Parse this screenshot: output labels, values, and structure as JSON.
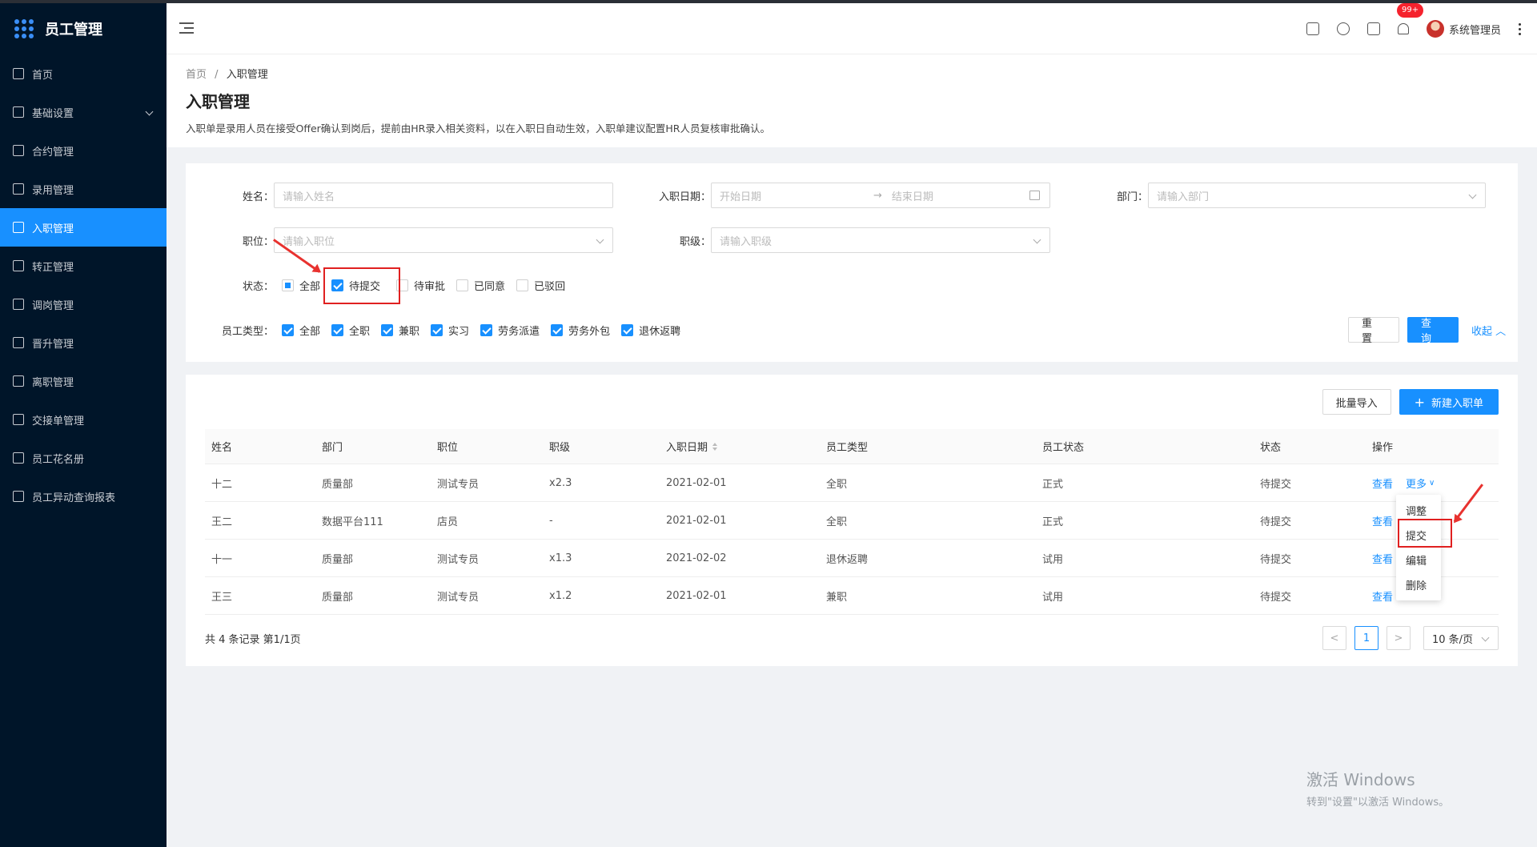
{
  "app": {
    "title": "员工管理"
  },
  "sidebar": {
    "items": [
      {
        "label": "首页"
      },
      {
        "label": "基础设置"
      },
      {
        "label": "合约管理"
      },
      {
        "label": "录用管理"
      },
      {
        "label": "入职管理"
      },
      {
        "label": "转正管理"
      },
      {
        "label": "调岗管理"
      },
      {
        "label": "晋升管理"
      },
      {
        "label": "离职管理"
      },
      {
        "label": "交接单管理"
      },
      {
        "label": "员工花名册"
      },
      {
        "label": "员工异动查询报表"
      }
    ]
  },
  "header": {
    "badge": "99+",
    "user": "系统管理员"
  },
  "page": {
    "breadcrumb": [
      "首页",
      "入职管理"
    ],
    "title": "入职管理",
    "description": "入职单是录用人员在接受Offer确认到岗后，提前由HR录入相关资料，以在入职日自动生效，入职单建议配置HR人员复核审批确认。"
  },
  "filters": {
    "name_label": "姓名：",
    "name_placeholder": "请输入姓名",
    "date_label": "入职日期：",
    "date_start": "开始日期",
    "date_end": "结束日期",
    "dept_label": "部门：",
    "dept_placeholder": "请输入部门",
    "position_label": "职位：",
    "position_placeholder": "请输入职位",
    "level_label": "职级：",
    "level_placeholder": "请输入职级",
    "status_label": "状态：",
    "status_options": [
      {
        "label": "全部",
        "checked": "partial"
      },
      {
        "label": "待提交",
        "checked": "true"
      },
      {
        "label": "待审批",
        "checked": "false"
      },
      {
        "label": "已同意",
        "checked": "false"
      },
      {
        "label": "已驳回",
        "checked": "false"
      }
    ],
    "type_label": "员工类型：",
    "type_options": [
      {
        "label": "全部"
      },
      {
        "label": "全职"
      },
      {
        "label": "兼职"
      },
      {
        "label": "实习"
      },
      {
        "label": "劳务派遣"
      },
      {
        "label": "劳务外包"
      },
      {
        "label": "退休返聘"
      }
    ],
    "reset": "重 置",
    "search": "查 询",
    "collapse": "收起"
  },
  "toolbar": {
    "import": "批量导入",
    "create": "新建入职单"
  },
  "table": {
    "columns": [
      "姓名",
      "部门",
      "职位",
      "职级",
      "入职日期",
      "员工类型",
      "员工状态",
      "状态",
      "操作"
    ],
    "rows": [
      [
        "十二",
        "质量部",
        "测试专员",
        "x2.3",
        "2021-02-01",
        "全职",
        "正式",
        "待提交"
      ],
      [
        "王二",
        "数据平台111",
        "店员",
        "-",
        "2021-02-01",
        "全职",
        "正式",
        "待提交"
      ],
      [
        "十一",
        "质量部",
        "测试专员",
        "x1.3",
        "2021-02-02",
        "退休返聘",
        "试用",
        "待提交"
      ],
      [
        "王三",
        "质量部",
        "测试专员",
        "x1.2",
        "2021-02-01",
        "兼职",
        "试用",
        "待提交"
      ]
    ],
    "view": "查看",
    "more": "更多",
    "more_menu": [
      "调整",
      "提交",
      "编辑",
      "删除"
    ]
  },
  "pagination": {
    "summary": "共 4 条记录 第1/1页",
    "current": "1",
    "page_size": "10 条/页",
    "prev": "<",
    "next": ">"
  },
  "watermark": {
    "line1": "激活 Windows",
    "line2": "转到\"设置\"以激活 Windows。"
  }
}
